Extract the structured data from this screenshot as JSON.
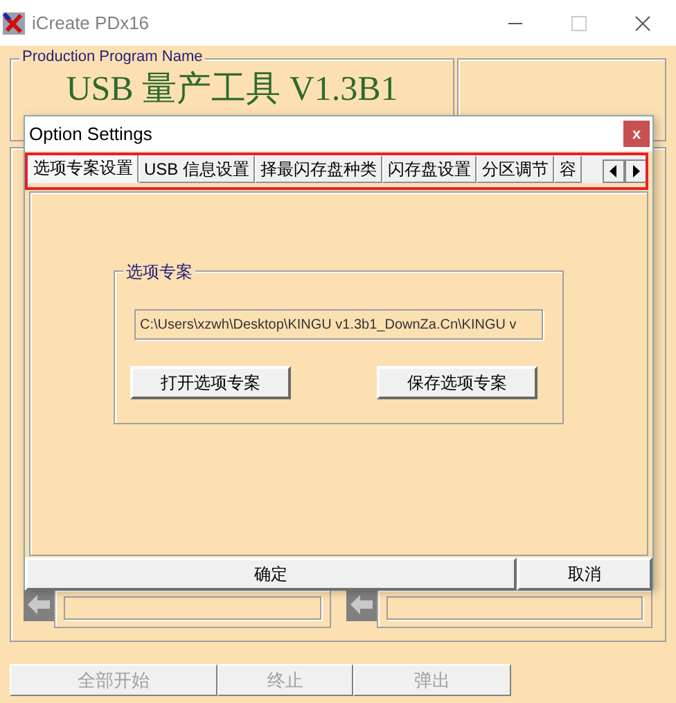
{
  "window": {
    "title": "iCreate PDx16"
  },
  "production_program": {
    "label": "Production Program Name",
    "name": "USB 量产工具 V1.3B1"
  },
  "bottom_buttons": [
    {
      "label": "全部开始",
      "disabled": true
    },
    {
      "label": "终止",
      "disabled": true
    },
    {
      "label": "弹出",
      "disabled": true
    }
  ],
  "dialog": {
    "title": "Option Settings",
    "close": "x",
    "tabs": [
      {
        "label": "选项专案设置",
        "selected": true
      },
      {
        "label": "USB 信息设置",
        "selected": false
      },
      {
        "label": "择最闪存盘种类",
        "selected": false
      },
      {
        "label": "闪存盘设置",
        "selected": false
      },
      {
        "label": "分区调节",
        "selected": false
      },
      {
        "label": "容",
        "selected": false
      }
    ],
    "group": {
      "label": "选项专案",
      "path": "C:\\Users\\xzwh\\Desktop\\KINGU v1.3b1_DownZa.Cn\\KINGU v",
      "buttons": [
        "打开选项专案",
        "保存选项专案"
      ]
    },
    "footer_buttons": [
      "确定",
      "取消"
    ]
  }
}
